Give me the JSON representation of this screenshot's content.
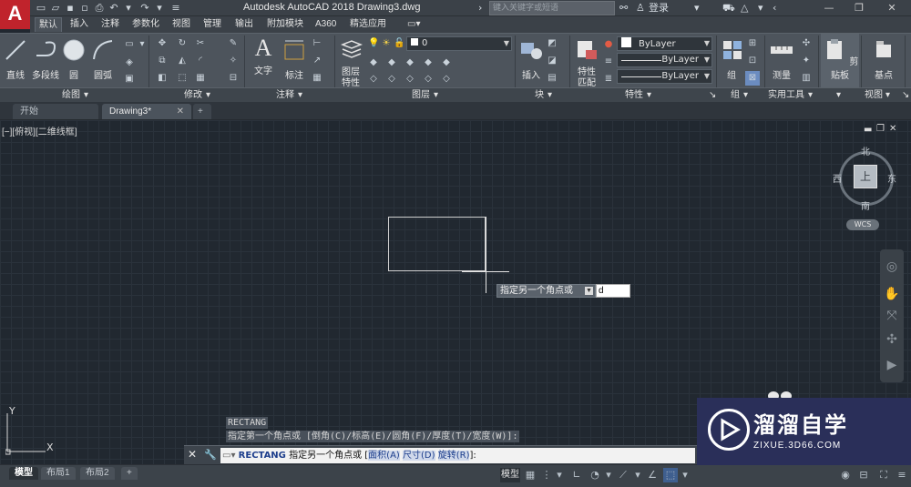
{
  "app": {
    "logo": "A",
    "title": "Autodesk AutoCAD 2018    Drawing3.dwg",
    "search_placeholder": "键入关键字或短语",
    "signin": "登录"
  },
  "ribbon_tabs": [
    "默认",
    "插入",
    "注释",
    "参数化",
    "视图",
    "管理",
    "输出",
    "附加模块",
    "A360",
    "精选应用"
  ],
  "ribbon": {
    "draw": {
      "line": "直线",
      "polyline": "多段线",
      "circle": "圆",
      "arc": "圆弧",
      "panel": "绘图"
    },
    "modify": {
      "panel": "修改"
    },
    "annotation": {
      "text": "文字",
      "dimension": "标注",
      "panel": "注释"
    },
    "layers": {
      "layer_props": "图层特性",
      "layer_combo": "0",
      "panel": "图层"
    },
    "block": {
      "insert": "插入",
      "panel": "块"
    },
    "properties": {
      "match": "特性匹配",
      "color": "ByLayer",
      "linetype": "ByLayer",
      "lineweight": "ByLayer",
      "panel": "特性"
    },
    "groups": {
      "group": "组",
      "panel": "组"
    },
    "utilities": {
      "measure": "测量",
      "panel": "实用工具"
    },
    "clipboard": {
      "clipboard": "剪贴板"
    },
    "view": {
      "base": "基点",
      "panel": "视图"
    }
  },
  "doc_tabs": [
    "开始",
    "Drawing3*"
  ],
  "viewport_label": "[−][俯视][二维线框]",
  "viewcube": {
    "north": "北",
    "south": "南",
    "east": "东",
    "west": "西",
    "top": "上",
    "wcs": "WCS"
  },
  "ucs": {
    "x": "X",
    "y": "Y"
  },
  "tooltip": {
    "prompt": "指定另一个角点或",
    "input_value": "d"
  },
  "command_history": [
    "RECTANG",
    "指定第一个角点或 [倒角(C)/标高(E)/圆角(F)/厚度(T)/宽度(W)]:"
  ],
  "command_line": {
    "command": "RECTANG",
    "prompt": "指定另一个角点或",
    "opt1": "面积(A)",
    "opt2": "尺寸(D)",
    "opt3": "旋转(R)"
  },
  "layout_tabs": [
    "模型",
    "布局1",
    "布局2"
  ],
  "status": {
    "model": "模型"
  },
  "watermark": {
    "title": "溜溜自学",
    "url": "ZIXUE.3D66.COM"
  }
}
